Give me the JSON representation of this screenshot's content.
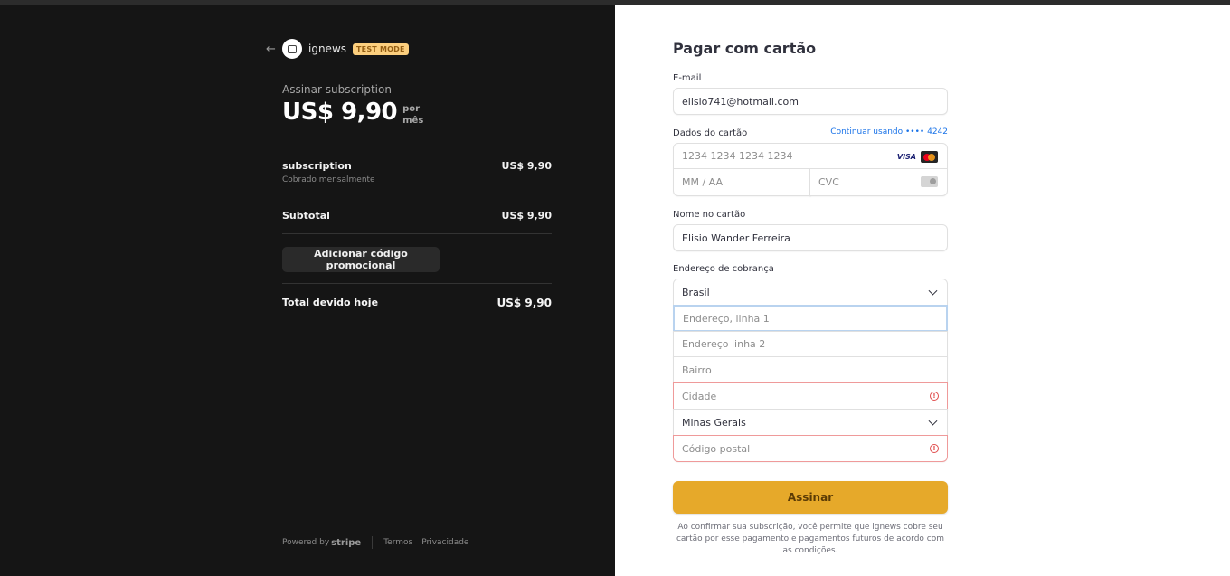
{
  "summary": {
    "brand_name": "ignews",
    "test_mode_badge": "TEST MODE",
    "plan_title": "Assinar subscription",
    "price": "US$ 9,90",
    "per_line1": "por",
    "per_line2": "mês",
    "items": [
      {
        "name": "subscription",
        "desc": "Cobrado mensalmente",
        "amount": "US$ 9,90"
      }
    ],
    "subtotal_label": "Subtotal",
    "subtotal_amount": "US$ 9,90",
    "promo_button": "Adicionar código promocional",
    "total_label": "Total devido hoje",
    "total_amount": "US$ 9,90",
    "footer": {
      "powered_by": "Powered by",
      "stripe": "stripe",
      "terms": "Termos",
      "privacy": "Privacidade"
    }
  },
  "form": {
    "title": "Pagar com cartão",
    "email_label": "E-mail",
    "email_value": "elisio741@hotmail.com",
    "card_label": "Dados do cartão",
    "continue_link": "Continuar usando •••• 4242",
    "card_number_placeholder": "1234 1234 1234 1234",
    "card_brand_visa": "VISA",
    "expiry_placeholder": "MM / AA",
    "cvc_placeholder": "CVC",
    "name_label": "Nome no cartão",
    "name_value": "Elisio Wander Ferreira",
    "address_label": "Endereço de cobrança",
    "country_value": "Brasil",
    "address1_placeholder": "Endereço, linha 1",
    "address2_placeholder": "Endereço linha 2",
    "neighborhood_placeholder": "Bairro",
    "city_placeholder": "Cidade",
    "state_value": "Minas Gerais",
    "postal_placeholder": "Código postal",
    "submit_label": "Assinar",
    "legal_text": "Ao confirmar sua subscrição, você permite que ignews cobre seu cartão por esse pagamento e pagamentos futuros de acordo com as condições."
  },
  "colors": {
    "left_bg": "#151515",
    "submit_bg": "#e6a92a",
    "test_badge_bg": "#fccf7e",
    "error_border": "#ef9a9a",
    "link": "#1a73e8"
  },
  "icons": [
    "back-arrow-icon",
    "store-icon",
    "visa-icon",
    "mastercard-icon",
    "cvc-card-icon",
    "error-icon",
    "chevron-down-icon"
  ]
}
